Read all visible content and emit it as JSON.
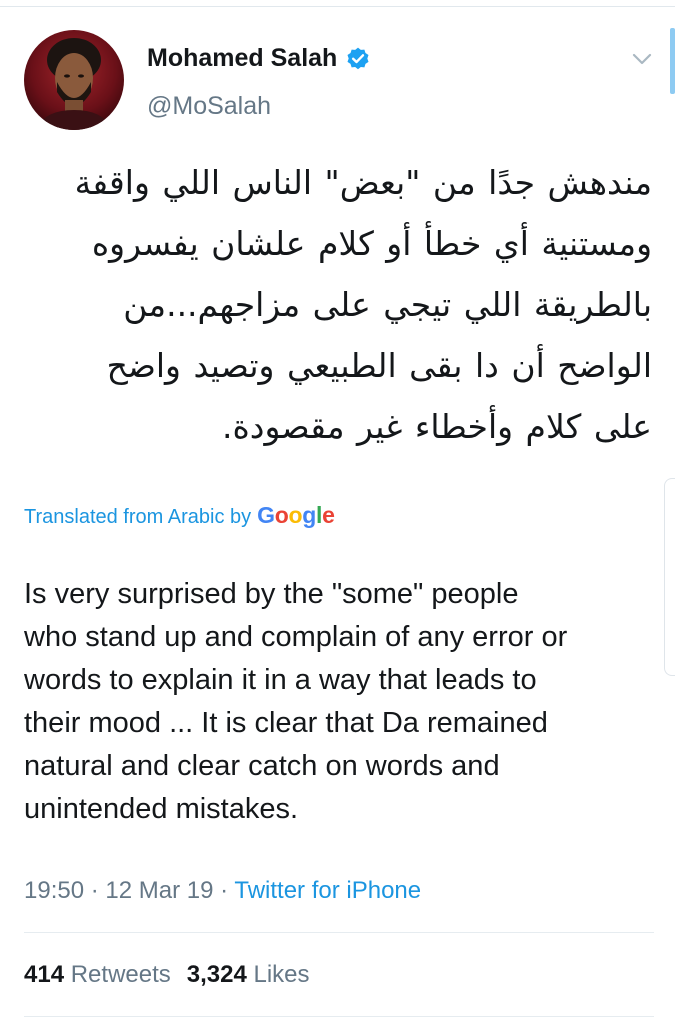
{
  "tweet": {
    "display_name": "Mohamed Salah",
    "handle": "@MoSalah",
    "arabic_lines": [
      "مندهش جدًا من \"بعض\" الناس اللي واقفة",
      "ومستنية أي خطأ أو كلام علشان يفسروه",
      "بالطريقة اللي تيجي على مزاجهم...من",
      "الواضح أن دا بقى الطبيعي وتصيد واضح",
      "على كلام وأخطاء غير مقصودة."
    ],
    "translation_label": "Translated from Arabic by",
    "translation_provider": {
      "letters": [
        "G",
        "o",
        "o",
        "g",
        "l",
        "e"
      ]
    },
    "english_lines": [
      "Is very surprised by the \"some\" people",
      "who stand up and complain of any error or",
      "words to explain it in a way that leads to",
      "their mood ... It is clear that Da remained",
      "natural and clear catch on words and",
      "unintended mistakes."
    ],
    "time": "19:50",
    "date": "12 Mar 19",
    "source": "Twitter for iPhone",
    "separator": "·",
    "retweets_count": "414",
    "retweets_label": "Retweets",
    "likes_count": "3,324",
    "likes_label": "Likes"
  },
  "colors": {
    "link_blue": "#1b95e0",
    "secondary_gray": "#657786",
    "text_primary": "#14171a",
    "verified_blue": "#1da1f2"
  },
  "icons": {
    "avatar": "profile-photo",
    "verified": "verified-badge-icon",
    "caret": "chevron-down-icon"
  }
}
